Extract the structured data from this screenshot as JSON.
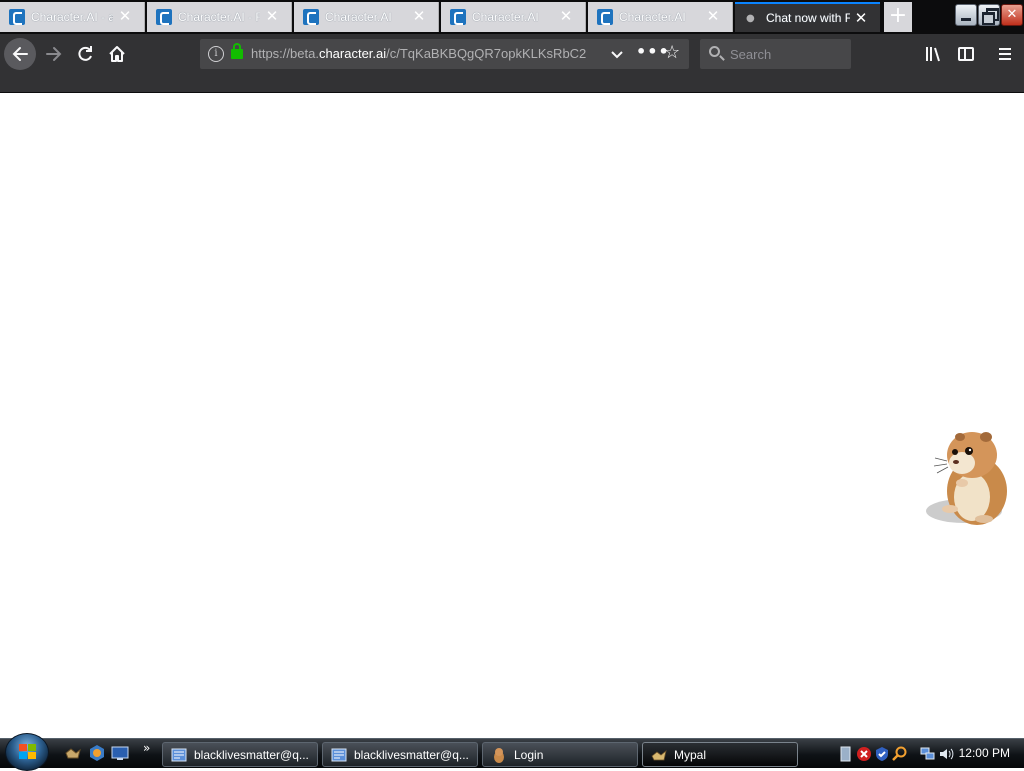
{
  "browser": {
    "tabs": [
      {
        "title": "Character.AI - a",
        "active": false
      },
      {
        "title": "Character.AI - R",
        "active": false
      },
      {
        "title": "Character.AI",
        "active": false
      },
      {
        "title": "Character.AI",
        "active": false
      },
      {
        "title": "Character.AI",
        "active": false
      },
      {
        "title": "Chat now with F",
        "active": true
      }
    ],
    "new_tab_label": "+",
    "url": {
      "prefix": "https://beta.",
      "domain": "character.ai",
      "path": "/c/TqKaBKBQgQR7opkKLKsRbC2",
      "secure": true
    },
    "search": {
      "placeholder": "Search",
      "value": ""
    },
    "icons": {
      "back": "back-arrow-icon",
      "forward": "forward-arrow-icon",
      "reload": "reload-icon",
      "home": "home-icon",
      "info": "info-icon",
      "lock": "lock-icon",
      "dropdown": "chevron-down-icon",
      "more": "more-actions-icon",
      "bookmark": "star-icon",
      "library": "library-icon",
      "sidebar": "sidebar-icon",
      "menu": "hamburger-menu-icon"
    },
    "colors": {
      "tab_accent": "#0a84ff",
      "toolbar": "#323234",
      "lock": "#12bc00"
    }
  },
  "desktop_widget": {
    "name": "hamster-pet"
  },
  "taskbar": {
    "tasks": [
      {
        "label": "blacklivesmatter@q...",
        "active": false
      },
      {
        "label": "blacklivesmatter@q...",
        "active": false
      },
      {
        "label": "Login",
        "active": false
      },
      {
        "label": "Mypal",
        "active": true
      }
    ],
    "quick_launch_more": "»",
    "clock": "12:00 PM"
  }
}
